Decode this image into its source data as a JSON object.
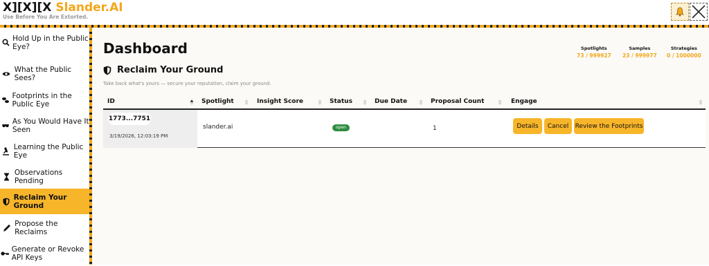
{
  "header": {
    "brand_mark": "X][X][X",
    "brand_name": "Slander.AI",
    "tagline": "Use Before You Are Extorted."
  },
  "sidebar": {
    "items": [
      {
        "label": "Hold Up in the Public Eye?",
        "icon": "search-icon"
      },
      {
        "label": "What the Public Sees?",
        "icon": "eye-icon"
      },
      {
        "label": "Footprints in the Public Eye",
        "icon": "footprints-icon"
      },
      {
        "label": "As You Would Have It Seen",
        "icon": "face-icon"
      },
      {
        "label": "Learning the Public Eye",
        "icon": "microscope-icon"
      },
      {
        "label": "Observations Pending",
        "icon": "hourglass-icon"
      },
      {
        "label": "Reclaim Your Ground",
        "icon": "shield-icon",
        "active": true
      },
      {
        "label": "Propose the Reclaims",
        "icon": "pencil-icon"
      },
      {
        "label": "Generate or Revoke API Keys",
        "icon": "key-icon"
      }
    ]
  },
  "main": {
    "title": "Dashboard",
    "stats": [
      {
        "label": "Spotlights",
        "value": "73 / 999927"
      },
      {
        "label": "Samples",
        "value": "23 / 999977"
      },
      {
        "label": "Strategies",
        "value": "0 / 1000000"
      }
    ],
    "section_title": "Reclaim Your Ground",
    "section_sub": "Take back what's yours — secure your reputation, claim your ground."
  },
  "table": {
    "columns": [
      "ID",
      "Spotlight",
      "Insight Score",
      "Status",
      "Due Date",
      "Proposal Count",
      "Engage"
    ],
    "rows": [
      {
        "id": "1773...7751",
        "date": "3/19/2026, 12:03:19 PM",
        "spotlight": "slander.ai",
        "insight_score": "",
        "status": "open",
        "due_date": "",
        "proposal_count": "1",
        "actions": [
          "Details",
          "Cancel",
          "Review the Footprints"
        ]
      }
    ]
  },
  "colors": {
    "accent": "#f7b52a",
    "status_open": "#2e8b3e"
  }
}
